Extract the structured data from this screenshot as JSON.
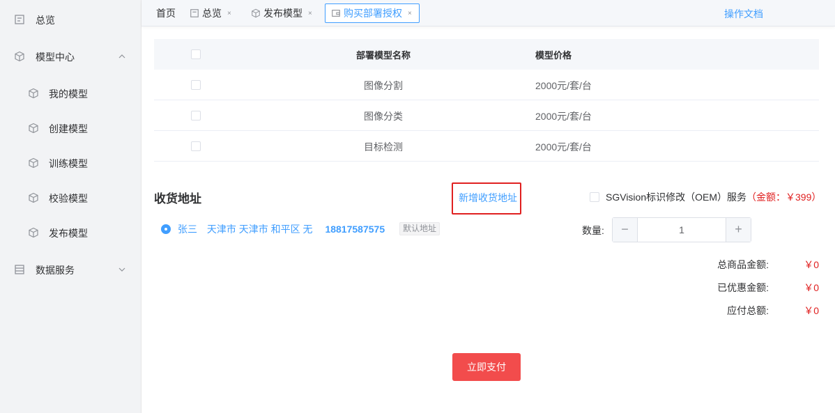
{
  "sidebar": {
    "overview": "总览",
    "model_center": "模型中心",
    "sub_items": [
      "我的模型",
      "创建模型",
      "训练模型",
      "校验模型",
      "发布模型"
    ],
    "data_service": "数据服务"
  },
  "tabs": {
    "home": "首页",
    "overview": "总览",
    "publish": "发布模型",
    "purchase": "购买部署授权",
    "close_glyph": "×",
    "doc_link": "操作文档"
  },
  "table": {
    "header_name": "部署模型名称",
    "header_price": "模型价格",
    "rows": [
      {
        "name": "图像分割",
        "price": "2000元/套/台"
      },
      {
        "name": "图像分类",
        "price": "2000元/套/台"
      },
      {
        "name": "目标检测",
        "price": "2000元/套/台"
      }
    ]
  },
  "address": {
    "title": "收货地址",
    "add_label": "新增收货地址",
    "name": "张三",
    "region": "天津市 天津市 和平区 无",
    "phone": "18817587575",
    "default_tag": "默认地址"
  },
  "oem": {
    "label": "SGVision标识修改（OEM）服务",
    "price": "（金额：￥399）"
  },
  "quantity": {
    "label": "数量:",
    "value": "1",
    "minus": "−",
    "plus": "+"
  },
  "totals": {
    "goods_label": "总商品金额:",
    "goods_value": "￥0",
    "discount_label": "已优惠金额:",
    "discount_value": "￥0",
    "payable_label": "应付总额:",
    "payable_value": "￥0"
  },
  "pay_button": "立即支付",
  "colors": {
    "accent": "#409eff",
    "danger": "#e02020",
    "pay_button": "#f24c4c"
  }
}
